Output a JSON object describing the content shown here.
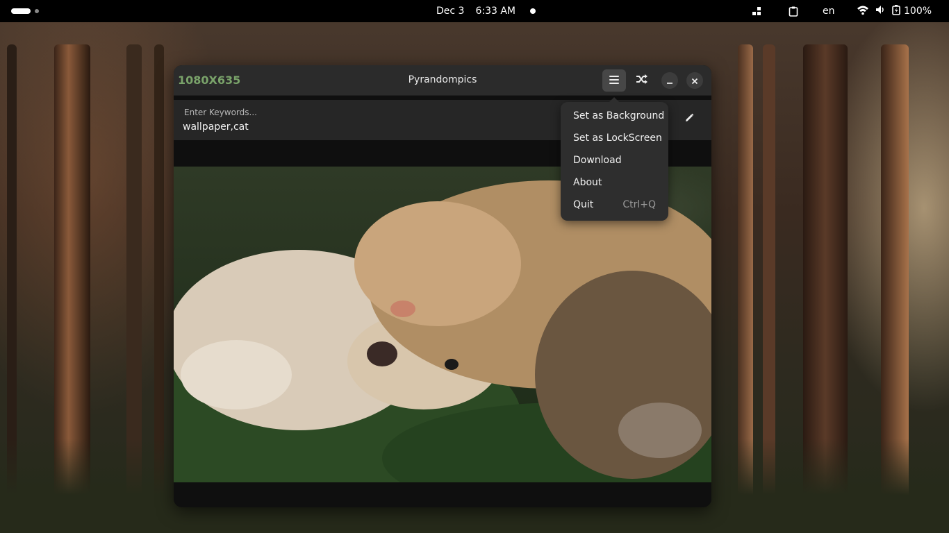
{
  "topbar": {
    "date": "Dec 3",
    "time": "6:33 AM",
    "language": "en",
    "battery": "100%"
  },
  "window": {
    "resolution": "1080X635",
    "title": "Pyrandompics",
    "keywords_placeholder": "Enter Keywords...",
    "keywords_value": "wallpaper,cat"
  },
  "menu": {
    "items": [
      {
        "label": "Set as Background",
        "accel": ""
      },
      {
        "label": "Set as LockScreen",
        "accel": ""
      },
      {
        "label": "Download",
        "accel": ""
      },
      {
        "label": "About",
        "accel": ""
      },
      {
        "label": "Quit",
        "accel": "Ctrl+Q"
      }
    ]
  },
  "colors": {
    "resolution_text": "#7aa36a",
    "window_bg": "#0f0f0f",
    "header_bg": "#2b2b2b",
    "popover_bg": "#2e2e2e"
  },
  "icons": {
    "menu": "hamburger-icon",
    "shuffle": "shuffle-icon",
    "minimize": "minimize-icon",
    "close": "close-icon",
    "edit": "pencil-icon"
  }
}
